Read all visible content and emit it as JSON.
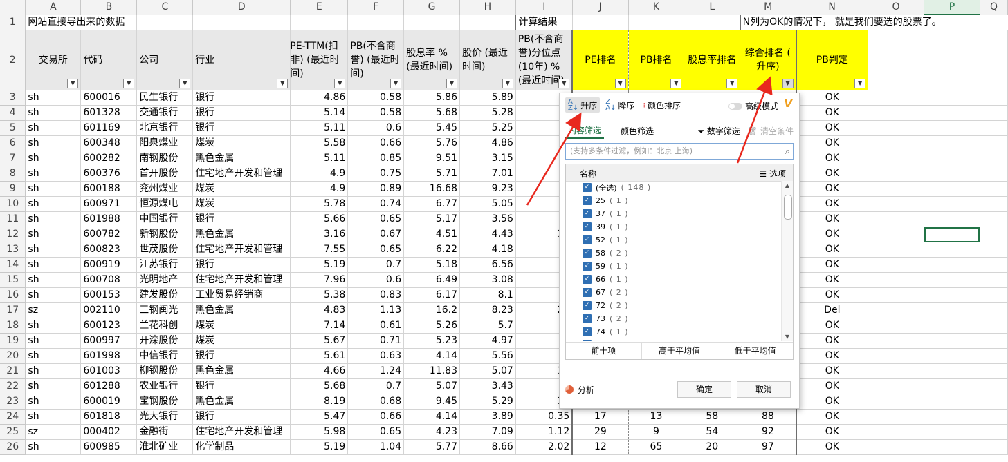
{
  "columns": [
    "A",
    "B",
    "C",
    "D",
    "E",
    "F",
    "G",
    "H",
    "I",
    "J",
    "K",
    "L",
    "M",
    "N",
    "O",
    "P",
    "Q"
  ],
  "row1": {
    "a": "网站直接导出来的数据",
    "j": "计算结果",
    "n": "N列为OK的情况下， 就是我们要选的股票了。"
  },
  "headers": {
    "a": "交易所",
    "b": "代码",
    "c": "公司",
    "d": "行业",
    "e": "PE-TTM(扣非) (最近时间)",
    "f": "PB(不含商誉) (最近时间)",
    "g": "股息率 % (最近时间)",
    "h": "股价 (最近时间)",
    "i": "PB(不含商誉)分位点(10年) % (最近时间)",
    "j": "PE排名",
    "k": "PB排名",
    "l": "股息率排名",
    "m": "综合排名 ( 升序)",
    "n": "PB判定"
  },
  "rows": [
    {
      "n": "3",
      "a": "sh",
      "b": "600016",
      "c": "民生银行",
      "d": "银行",
      "e": "4.86",
      "f": "0.58",
      "g": "5.86",
      "h": "5.89",
      "i": "0",
      "j": "",
      "k": "",
      "l": "",
      "m": "",
      "r": "OK"
    },
    {
      "n": "4",
      "a": "sh",
      "b": "601328",
      "c": "交通银行",
      "d": "银行",
      "e": "5.14",
      "f": "0.58",
      "g": "5.68",
      "h": "5.28",
      "i": "0",
      "j": "",
      "k": "",
      "l": "",
      "m": "",
      "r": "OK"
    },
    {
      "n": "5",
      "a": "sh",
      "b": "601169",
      "c": "北京银行",
      "d": "银行",
      "e": "5.11",
      "f": "0.6",
      "g": "5.45",
      "h": "5.25",
      "i": "0",
      "j": "",
      "k": "",
      "l": "",
      "m": "",
      "r": "OK"
    },
    {
      "n": "6",
      "a": "sh",
      "b": "600348",
      "c": "阳泉煤业",
      "d": "煤炭",
      "e": "5.58",
      "f": "0.66",
      "g": "5.76",
      "h": "4.86",
      "i": "0",
      "j": "",
      "k": "",
      "l": "",
      "m": "",
      "r": "OK"
    },
    {
      "n": "7",
      "a": "sh",
      "b": "600282",
      "c": "南钢股份",
      "d": "黑色金属",
      "e": "5.11",
      "f": "0.85",
      "g": "9.51",
      "h": "3.15",
      "i": "1",
      "j": "",
      "k": "",
      "l": "",
      "m": "",
      "r": "OK"
    },
    {
      "n": "8",
      "a": "sh",
      "b": "600376",
      "c": "首开股份",
      "d": "住宅地产开发和管理",
      "e": "4.9",
      "f": "0.75",
      "g": "5.71",
      "h": "7.01",
      "i": "3",
      "j": "",
      "k": "",
      "l": "",
      "m": "",
      "r": "OK"
    },
    {
      "n": "9",
      "a": "sh",
      "b": "600188",
      "c": "兖州煤业",
      "d": "煤炭",
      "e": "4.9",
      "f": "0.89",
      "g": "16.68",
      "h": "9.23",
      "i": "5",
      "j": "",
      "k": "",
      "l": "",
      "m": "",
      "r": "OK"
    },
    {
      "n": "10",
      "a": "sh",
      "b": "600971",
      "c": "恒源煤电",
      "d": "煤炭",
      "e": "5.78",
      "f": "0.74",
      "g": "6.77",
      "h": "5.05",
      "i": "",
      "j": "",
      "k": "",
      "l": "",
      "m": "",
      "r": "OK"
    },
    {
      "n": "11",
      "a": "sh",
      "b": "601988",
      "c": "中国银行",
      "d": "银行",
      "e": "5.66",
      "f": "0.65",
      "g": "5.17",
      "h": "3.56",
      "i": "0",
      "j": "",
      "k": "",
      "l": "",
      "m": "",
      "r": "OK"
    },
    {
      "n": "12",
      "a": "sh",
      "b": "600782",
      "c": "新钢股份",
      "d": "黑色金属",
      "e": "3.16",
      "f": "0.67",
      "g": "4.51",
      "h": "4.43",
      "i": "10",
      "j": "",
      "k": "",
      "l": "",
      "m": "",
      "r": "OK"
    },
    {
      "n": "13",
      "a": "sh",
      "b": "600823",
      "c": "世茂股份",
      "d": "住宅地产开发和管理",
      "e": "7.55",
      "f": "0.65",
      "g": "6.22",
      "h": "4.18",
      "i": "5",
      "j": "",
      "k": "",
      "l": "",
      "m": "",
      "r": "OK"
    },
    {
      "n": "14",
      "a": "sh",
      "b": "600919",
      "c": "江苏银行",
      "d": "银行",
      "e": "5.19",
      "f": "0.7",
      "g": "5.18",
      "h": "6.56",
      "i": "3",
      "j": "",
      "k": "",
      "l": "",
      "m": "",
      "r": "OK"
    },
    {
      "n": "15",
      "a": "sh",
      "b": "600708",
      "c": "光明地产",
      "d": "住宅地产开发和管理",
      "e": "7.96",
      "f": "0.6",
      "g": "6.49",
      "h": "3.08",
      "i": "0",
      "j": "",
      "k": "",
      "l": "",
      "m": "",
      "r": "OK"
    },
    {
      "n": "16",
      "a": "sh",
      "b": "600153",
      "c": "建发股份",
      "d": "工业贸易经销商",
      "e": "5.38",
      "f": "0.83",
      "g": "6.17",
      "h": "8.1",
      "i": "1",
      "j": "",
      "k": "",
      "l": "",
      "m": "",
      "r": "OK"
    },
    {
      "n": "17",
      "a": "sz",
      "b": "002110",
      "c": "三钢闽光",
      "d": "黑色金属",
      "e": "4.83",
      "f": "1.13",
      "g": "16.2",
      "h": "8.23",
      "i": "20",
      "j": "",
      "k": "",
      "l": "",
      "m": "",
      "r": "Del"
    },
    {
      "n": "18",
      "a": "sh",
      "b": "600123",
      "c": "兰花科创",
      "d": "煤炭",
      "e": "7.14",
      "f": "0.61",
      "g": "5.26",
      "h": "5.7",
      "i": "0",
      "j": "",
      "k": "",
      "l": "",
      "m": "",
      "r": "OK"
    },
    {
      "n": "19",
      "a": "sh",
      "b": "600997",
      "c": "开滦股份",
      "d": "煤炭",
      "e": "5.67",
      "f": "0.71",
      "g": "5.23",
      "h": "4.97",
      "i": "0",
      "j": "",
      "k": "",
      "l": "",
      "m": "",
      "r": "OK"
    },
    {
      "n": "20",
      "a": "sh",
      "b": "601998",
      "c": "中信银行",
      "d": "银行",
      "e": "5.61",
      "f": "0.63",
      "g": "4.14",
      "h": "5.56",
      "i": "0",
      "j": "",
      "k": "",
      "l": "",
      "m": "",
      "r": "OK"
    },
    {
      "n": "21",
      "a": "sh",
      "b": "601003",
      "c": "柳钢股份",
      "d": "黑色金属",
      "e": "4.66",
      "f": "1.24",
      "g": "11.83",
      "h": "5.07",
      "i": "10",
      "j": "",
      "k": "",
      "l": "",
      "m": "",
      "r": "OK"
    },
    {
      "n": "22",
      "a": "sh",
      "b": "601288",
      "c": "农业银行",
      "d": "银行",
      "e": "5.68",
      "f": "0.7",
      "g": "5.07",
      "h": "3.43",
      "i": "",
      "j": "",
      "k": "",
      "l": "",
      "m": "",
      "r": "OK"
    },
    {
      "n": "23",
      "a": "sh",
      "b": "600019",
      "c": "宝钢股份",
      "d": "黑色金属",
      "e": "8.19",
      "f": "0.68",
      "g": "9.45",
      "h": "5.29",
      "i": "14",
      "j": "",
      "k": "",
      "l": "",
      "m": "",
      "r": "OK"
    },
    {
      "n": "24",
      "a": "sh",
      "b": "601818",
      "c": "光大银行",
      "d": "银行",
      "e": "5.47",
      "f": "0.66",
      "g": "4.14",
      "h": "3.89",
      "i": "0.35",
      "j": "17",
      "k": "13",
      "l": "58",
      "m": "88",
      "r": "OK"
    },
    {
      "n": "25",
      "a": "sz",
      "b": "000402",
      "c": "金融街",
      "d": "住宅地产开发和管理",
      "e": "5.98",
      "f": "0.65",
      "g": "4.23",
      "h": "7.09",
      "i": "1.12",
      "j": "29",
      "k": "9",
      "l": "54",
      "m": "92",
      "r": "OK"
    },
    {
      "n": "26",
      "a": "sh",
      "b": "600985",
      "c": "淮北矿业",
      "d": "化学制品",
      "e": "5.19",
      "f": "1.04",
      "g": "5.77",
      "h": "8.66",
      "i": "2.02",
      "j": "12",
      "k": "65",
      "l": "20",
      "m": "97",
      "r": "OK"
    }
  ],
  "filter": {
    "asc": "升序",
    "desc": "降序",
    "color_sort": "颜色排序",
    "advanced": "高级模式",
    "tab_content": "内容筛选",
    "tab_color": "颜色筛选",
    "num_filter": "数字筛选",
    "clear": "清空条件",
    "search_placeholder": "(支持多条件过滤，例如：北京 上海)",
    "list_name": "名称",
    "list_options": "选项",
    "items": [
      {
        "label": "(全选)",
        "count": "( 148 )"
      },
      {
        "label": "25",
        "count": "( 1 )"
      },
      {
        "label": "37",
        "count": "( 1 )"
      },
      {
        "label": "39",
        "count": "( 1 )"
      },
      {
        "label": "52",
        "count": "( 1 )"
      },
      {
        "label": "58",
        "count": "( 2 )"
      },
      {
        "label": "59",
        "count": "( 1 )"
      },
      {
        "label": "66",
        "count": "( 1 )"
      },
      {
        "label": "67",
        "count": "( 2 )"
      },
      {
        "label": "72",
        "count": "( 2 )"
      },
      {
        "label": "73",
        "count": "( 2 )"
      },
      {
        "label": "74",
        "count": "( 1 )"
      },
      {
        "label": "76",
        "count": "( 1 )"
      }
    ],
    "top10": "前十项",
    "above_avg": "高于平均值",
    "below_avg": "低于平均值",
    "analysis": "分析",
    "ok": "确定",
    "cancel": "取消"
  },
  "colors": {
    "highlight": "#ffff00",
    "arrow": "#e8281e",
    "accent": "#217346"
  }
}
